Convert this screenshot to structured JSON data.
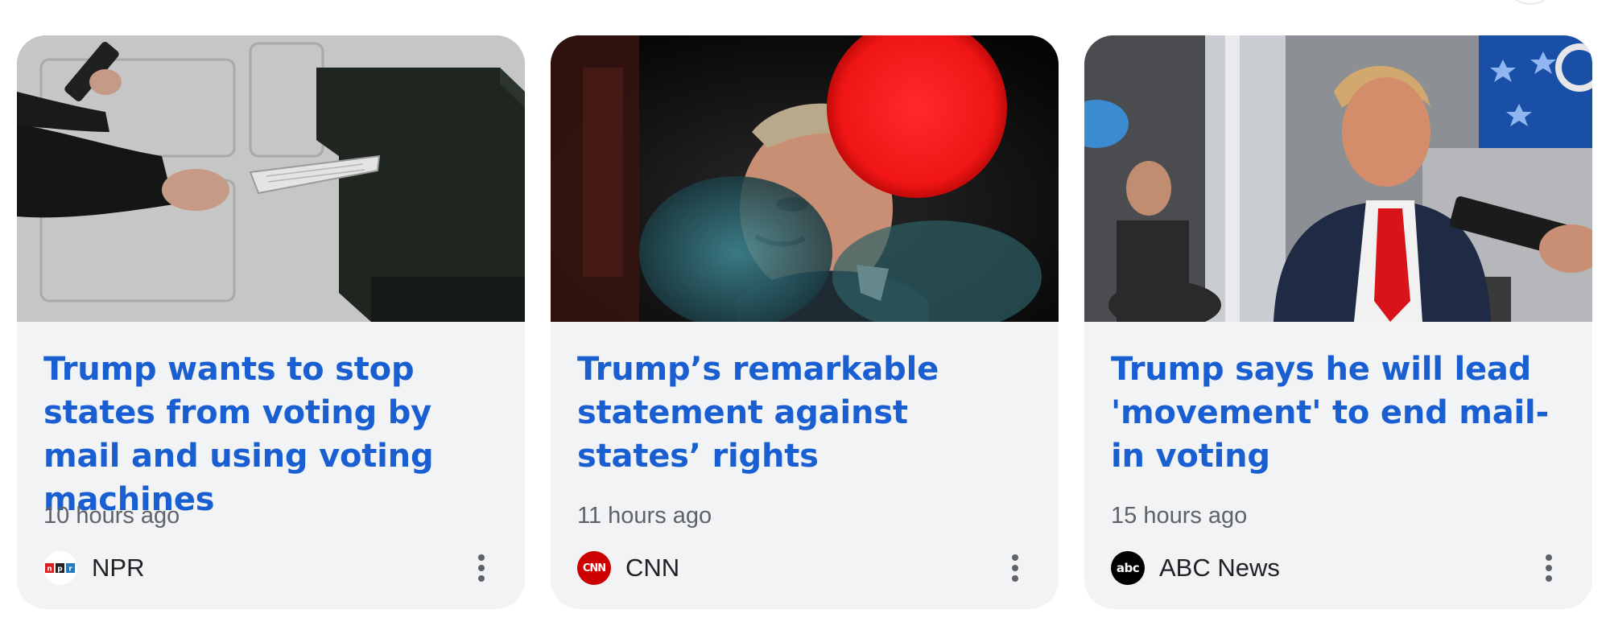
{
  "colors": {
    "card_background": "#f1f3f4",
    "headline": "#1a5fd1",
    "timestamp": "#5f6368",
    "source": "#202124",
    "cnn_red": "#cc0000",
    "abc_black": "#000000"
  },
  "stories": [
    {
      "headline": "Trump wants to stop states from voting by mail and using voting machines",
      "time": "10 hours ago",
      "source": "NPR",
      "logo_icon": "npr-logo-icon",
      "more_icon": "more-vert-icon"
    },
    {
      "headline": "Trump’s remarkable statement against states’ rights",
      "time": "11 hours ago",
      "source": "CNN",
      "logo_icon": "cnn-logo-icon",
      "logo_text": "CNN",
      "more_icon": "more-vert-icon"
    },
    {
      "headline": "Trump says he will lead 'movement' to end mail-in voting",
      "time": "15 hours ago",
      "source": "ABC News",
      "logo_icon": "abc-logo-icon",
      "logo_text": "abc",
      "more_icon": "more-vert-icon"
    }
  ]
}
